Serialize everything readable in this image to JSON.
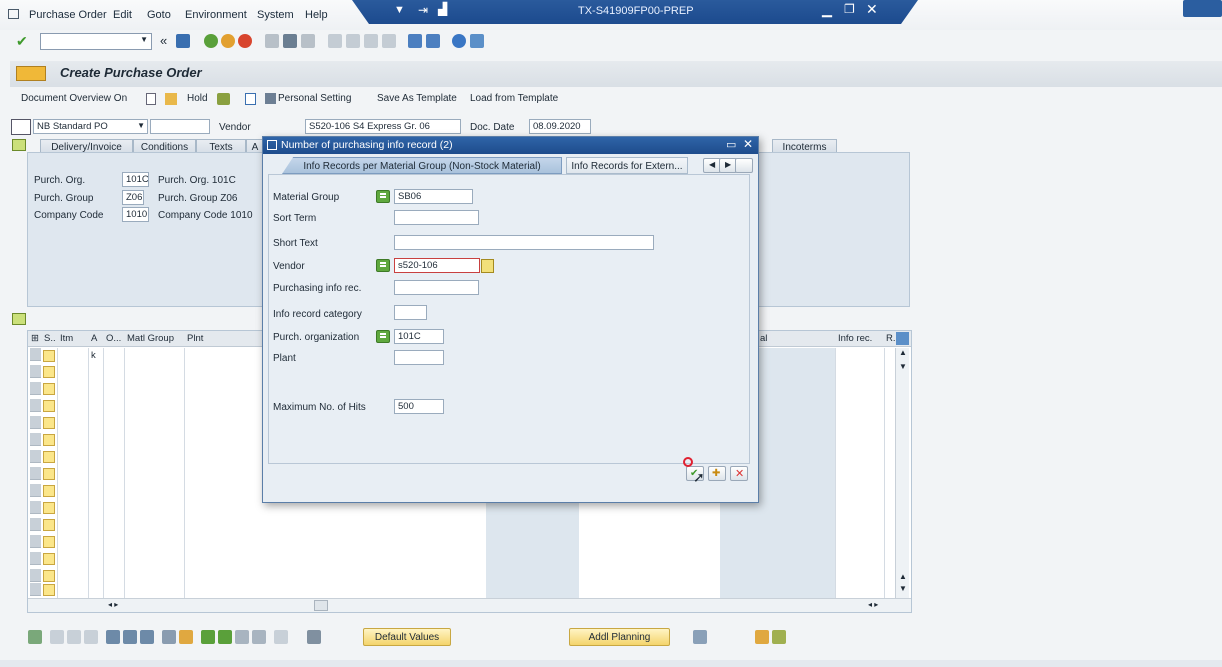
{
  "menu": {
    "purchase_order": "Purchase Order",
    "edit": "Edit",
    "goto": "Goto",
    "environment": "Environment",
    "system": "System",
    "help": "Help"
  },
  "window": {
    "title": "TX-S41909FP00-PREP"
  },
  "header": {
    "title": "Create Purchase Order"
  },
  "app_toolbar": {
    "doc_overview": "Document Overview On",
    "hold": "Hold",
    "personal_setting": "Personal Setting",
    "save_template": "Save As Template",
    "load_template": "Load from Template"
  },
  "po": {
    "doc_type": "NB Standard PO",
    "vendor_label": "Vendor",
    "vendor_value": "S520-106 S4 Express Gr. 06",
    "doc_date_label": "Doc. Date",
    "doc_date": "08.09.2020"
  },
  "tabs": {
    "delivery": "Delivery/Invoice",
    "conditions": "Conditions",
    "texts": "Texts",
    "a": "A",
    "incoterms": "Incoterms"
  },
  "org": {
    "purch_org_label": "Purch. Org.",
    "purch_org_code": "101C",
    "purch_org_desc": "Purch. Org. 101C",
    "purch_group_label": "Purch. Group",
    "purch_group_code": "Z06",
    "purch_group_desc": "Purch. Group Z06",
    "company_label": "Company Code",
    "company_code": "1010",
    "company_desc": "Company Code 1010"
  },
  "grid": {
    "headers": {
      "s": "S..",
      "itm": "Itm",
      "a": "A",
      "o": "O...",
      "matl_group": "Matl Group",
      "plnt": "Plnt",
      "al": "al",
      "info_rec": "Info rec.",
      "r": "R."
    },
    "row1_a": "k"
  },
  "bottom": {
    "default_values": "Default Values",
    "addl_planning": "Addl Planning"
  },
  "dialog": {
    "title": "Number of purchasing info record (2)",
    "tab_active": "Info Records per Material Group (Non-Stock Material)",
    "tab_other": "Info Records for Extern...",
    "fields": {
      "material_group_label": "Material Group",
      "material_group": "SB06",
      "sort_term_label": "Sort Term",
      "short_text_label": "Short Text",
      "vendor_label": "Vendor",
      "vendor": "s520-106",
      "info_rec_label": "Purchasing info rec.",
      "category_label": "Info record category",
      "purch_org_label": "Purch. organization",
      "purch_org": "101C",
      "plant_label": "Plant",
      "max_hits_label": "Maximum No. of Hits",
      "max_hits": "500"
    }
  },
  "colors": {
    "titlebar": "#1c4a8e",
    "accent": "#f4d46c"
  }
}
